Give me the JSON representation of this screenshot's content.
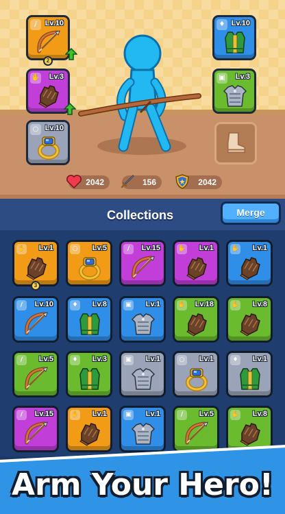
{
  "equipped": {
    "bow": {
      "level": "Lv.10",
      "stars": "2"
    },
    "glove": {
      "level": "Lv.3"
    },
    "ring": {
      "level": "Lv.10"
    },
    "vest": {
      "level": "Lv.10"
    },
    "armor": {
      "level": "Lv.3"
    }
  },
  "stats": {
    "health": "2042",
    "attack": "156",
    "defense": "2042"
  },
  "collections": {
    "title": "Collections",
    "merge_label": "Merge"
  },
  "cards": [
    {
      "item": "glove",
      "color": "orange",
      "level": "Lv.1",
      "stars": "3"
    },
    {
      "item": "ring",
      "color": "orange",
      "level": "Lv.5"
    },
    {
      "item": "bow",
      "color": "purple",
      "level": "Lv.15"
    },
    {
      "item": "glove",
      "color": "purple",
      "level": "Lv.1"
    },
    {
      "item": "glove",
      "color": "blue",
      "level": "Lv.1"
    },
    {
      "item": "bow",
      "color": "blue",
      "level": "Lv.10"
    },
    {
      "item": "vest",
      "color": "blue",
      "level": "Lv.8"
    },
    {
      "item": "armor",
      "color": "blue",
      "level": "Lv.1"
    },
    {
      "item": "glove",
      "color": "green",
      "level": "Lv.18"
    },
    {
      "item": "glove",
      "color": "green",
      "level": "Lv.8"
    },
    {
      "item": "bow",
      "color": "green",
      "level": "Lv.5"
    },
    {
      "item": "vest",
      "color": "green",
      "level": "Lv.3"
    },
    {
      "item": "armor",
      "color": "gray",
      "level": "Lv.1"
    },
    {
      "item": "ring",
      "color": "gray",
      "level": "Lv.1"
    },
    {
      "item": "vest",
      "color": "gray",
      "level": "Lv.1"
    },
    {
      "item": "bow",
      "color": "purple",
      "level": "Lv.15"
    },
    {
      "item": "glove",
      "color": "orange",
      "level": "Lv.1"
    },
    {
      "item": "armor",
      "color": "blue",
      "level": "Lv.1"
    },
    {
      "item": "bow",
      "color": "green",
      "level": "Lv.5"
    },
    {
      "item": "glove",
      "color": "green",
      "level": "Lv.8"
    }
  ],
  "banner": {
    "text": "Arm Your Hero!"
  },
  "colors": {
    "orange": "#f29b17",
    "purple": "#c13ed9",
    "blue": "#2f8ee8",
    "green": "#6abb2d",
    "gray": "#9aa3b8"
  }
}
